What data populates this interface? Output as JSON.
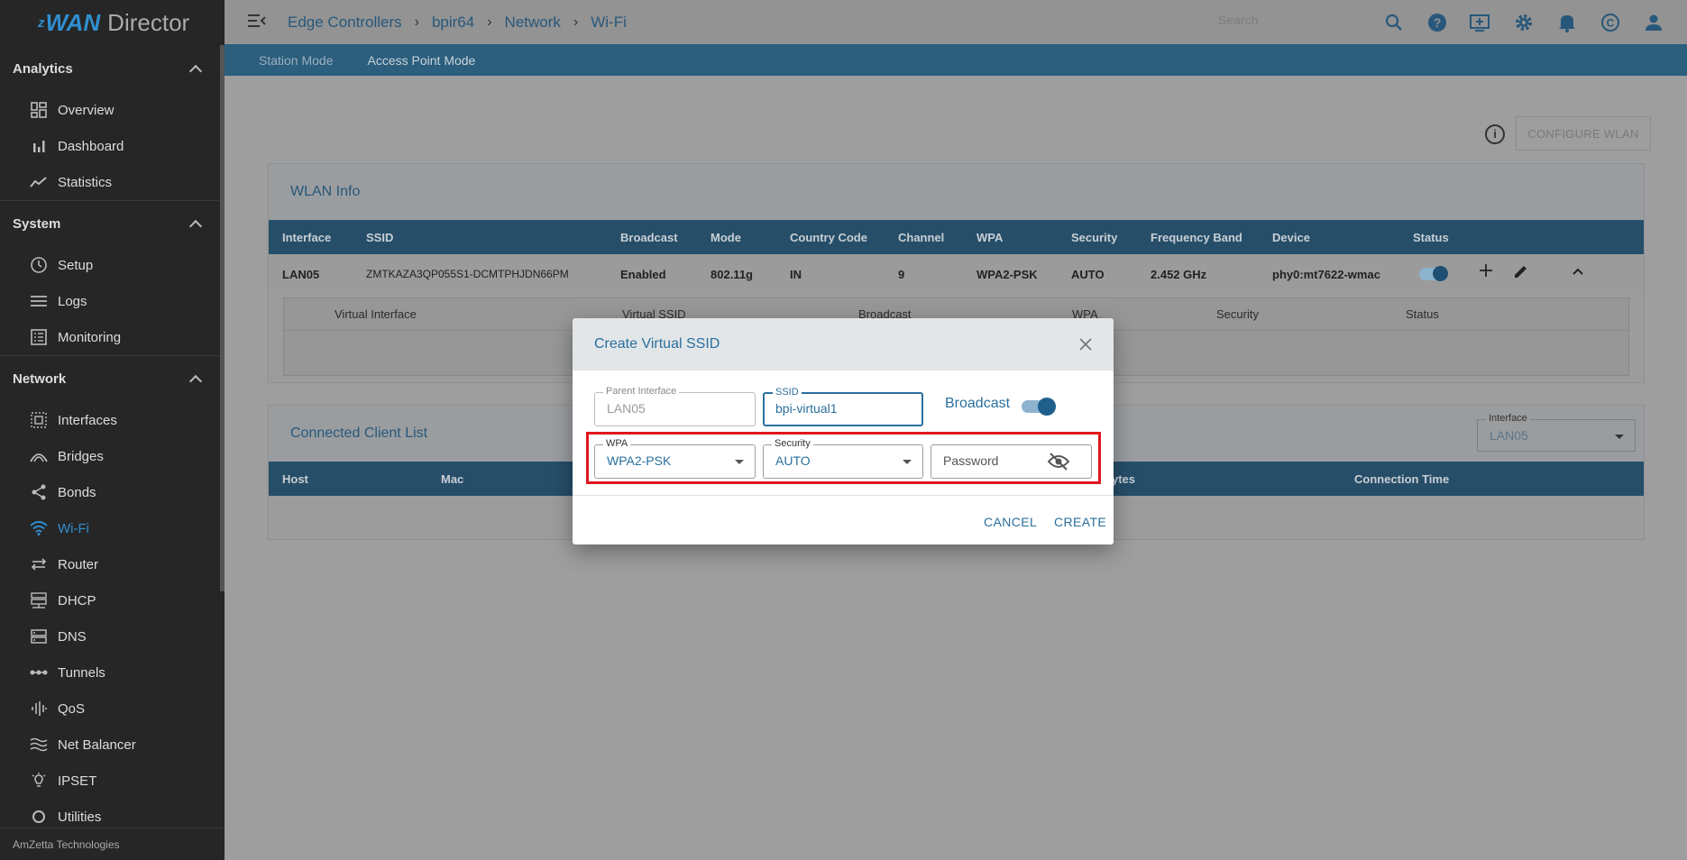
{
  "brand": {
    "z": "z",
    "wan": "WAN",
    "director": "Director"
  },
  "sidebar": {
    "sections": [
      {
        "title": "Analytics",
        "items": [
          {
            "label": "Overview",
            "icon": "grid-icon"
          },
          {
            "label": "Dashboard",
            "icon": "bar-chart-icon"
          },
          {
            "label": "Statistics",
            "icon": "trend-icon"
          }
        ]
      },
      {
        "title": "System",
        "items": [
          {
            "label": "Setup",
            "icon": "clock-icon"
          },
          {
            "label": "Logs",
            "icon": "list-icon"
          },
          {
            "label": "Monitoring",
            "icon": "monitor-list-icon"
          }
        ]
      },
      {
        "title": "Network",
        "items": [
          {
            "label": "Interfaces",
            "icon": "interfaces-icon"
          },
          {
            "label": "Bridges",
            "icon": "bridge-icon"
          },
          {
            "label": "Bonds",
            "icon": "share-icon"
          },
          {
            "label": "Wi-Fi",
            "icon": "wifi-icon",
            "active": true
          },
          {
            "label": "Router",
            "icon": "router-arrows-icon"
          },
          {
            "label": "DHCP",
            "icon": "dhcp-icon"
          },
          {
            "label": "DNS",
            "icon": "dns-icon"
          },
          {
            "label": "Tunnels",
            "icon": "tunnel-icon"
          },
          {
            "label": "QoS",
            "icon": "qos-icon"
          },
          {
            "label": "Net Balancer",
            "icon": "waves-icon"
          },
          {
            "label": "IPSET",
            "icon": "bulb-icon"
          },
          {
            "label": "Utilities",
            "icon": "tools-icon"
          }
        ]
      }
    ],
    "footer": "AmZetta Technologies"
  },
  "topbar": {
    "breadcrumb": [
      "Edge Controllers",
      "bpir64",
      "Network",
      "Wi-Fi"
    ],
    "search_placeholder": "Search"
  },
  "tabs": [
    "Station Mode",
    "Access Point Mode"
  ],
  "configure_btn": "CONFIGURE WLAN",
  "wlan": {
    "title": "WLAN Info",
    "headers": [
      "Interface",
      "SSID",
      "Broadcast",
      "Mode",
      "Country Code",
      "Channel",
      "WPA",
      "Security",
      "Frequency Band",
      "Device",
      "Status"
    ],
    "row": [
      "LAN05",
      "ZMTKAZA3QP055S1-DCMTPHJDN66PM",
      "Enabled",
      "802.11g",
      "IN",
      "9",
      "WPA2-PSK",
      "AUTO",
      "2.452 GHz",
      "phy0:mt7622-wmac"
    ],
    "sub_headers": [
      "Virtual Interface",
      "Virtual SSID",
      "Broadcast",
      "WPA",
      "Security",
      "Status"
    ]
  },
  "clients": {
    "title": "Connected Client List",
    "interface_label": "Interface",
    "interface_value": "LAN05",
    "headers": [
      "Host",
      "Mac",
      "ytes",
      "Connection Time"
    ]
  },
  "dialog": {
    "title": "Create Virtual SSID",
    "parent_label": "Parent Interface",
    "parent_value": "LAN05",
    "ssid_label": "SSID",
    "ssid_value": "bpi-virtual1",
    "broadcast_label": "Broadcast",
    "wpa_label": "WPA",
    "wpa_value": "WPA2-PSK",
    "security_label": "Security",
    "security_value": "AUTO",
    "password_placeholder": "Password",
    "cancel": "CANCEL",
    "create": "CREATE"
  },
  "colors": {
    "accent": "#2a6f9d",
    "highlight": "#e0161e",
    "tabbar": "#2c5e7d"
  }
}
